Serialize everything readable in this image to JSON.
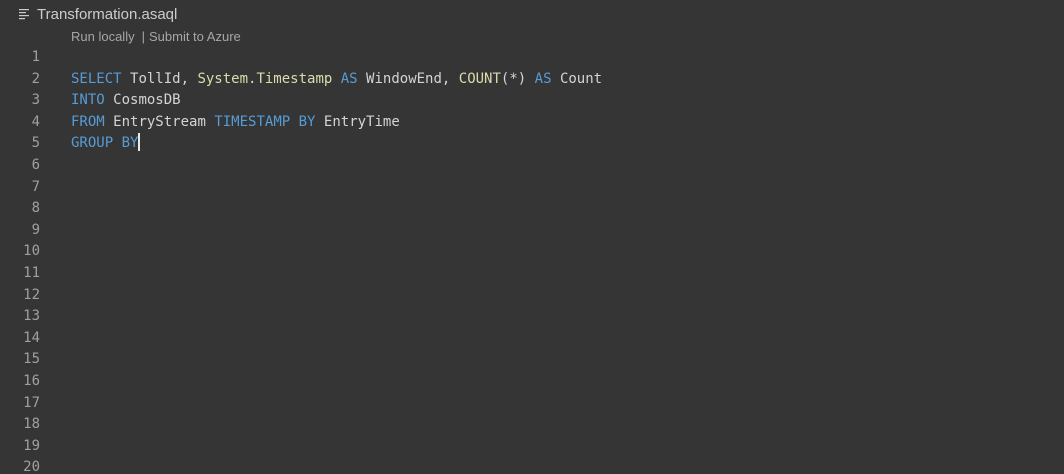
{
  "breadcrumb": {
    "file_name": "Transformation.asaql",
    "icon": "lines-icon"
  },
  "codelens": {
    "run_locally": "Run locally",
    "separator": "|",
    "submit_to_azure": "Submit to Azure"
  },
  "colors": {
    "background": "#353535",
    "keyword": "#569cd6",
    "function": "#dcdcaa",
    "identifier": "#d4d4d4",
    "line_number": "#a0a0a0"
  },
  "editor": {
    "line_numbers": [
      "1",
      "2",
      "3",
      "4",
      "5",
      "6",
      "7",
      "8",
      "9",
      "10",
      "11",
      "12",
      "13",
      "14",
      "15",
      "16",
      "17",
      "18",
      "19",
      "20"
    ],
    "lines": [
      [],
      [
        {
          "t": "SELECT",
          "c": "kw"
        },
        {
          "t": " ",
          "c": "plain"
        },
        {
          "t": "TollId",
          "c": "id"
        },
        {
          "t": ", ",
          "c": "plain"
        },
        {
          "t": "System.Timestamp",
          "c": "fn"
        },
        {
          "t": " ",
          "c": "plain"
        },
        {
          "t": "AS",
          "c": "kw"
        },
        {
          "t": " ",
          "c": "plain"
        },
        {
          "t": "WindowEnd",
          "c": "id"
        },
        {
          "t": ", ",
          "c": "plain"
        },
        {
          "t": "COUNT",
          "c": "fn"
        },
        {
          "t": "(*)",
          "c": "plain"
        },
        {
          "t": " ",
          "c": "plain"
        },
        {
          "t": "AS",
          "c": "kw"
        },
        {
          "t": " ",
          "c": "plain"
        },
        {
          "t": "Count",
          "c": "id"
        }
      ],
      [
        {
          "t": "INTO",
          "c": "kw"
        },
        {
          "t": " ",
          "c": "plain"
        },
        {
          "t": "CosmosDB",
          "c": "id"
        }
      ],
      [
        {
          "t": "FROM",
          "c": "kw"
        },
        {
          "t": " ",
          "c": "plain"
        },
        {
          "t": "EntryStream",
          "c": "id"
        },
        {
          "t": " ",
          "c": "plain"
        },
        {
          "t": "TIMESTAMP BY",
          "c": "kw"
        },
        {
          "t": " ",
          "c": "plain"
        },
        {
          "t": "EntryTime",
          "c": "id"
        }
      ],
      [
        {
          "t": "GROUP BY",
          "c": "kw"
        }
      ],
      [],
      [],
      [],
      [],
      [],
      [],
      [],
      [],
      [],
      [],
      [],
      [],
      [],
      [],
      []
    ],
    "cursor_line": 5
  }
}
